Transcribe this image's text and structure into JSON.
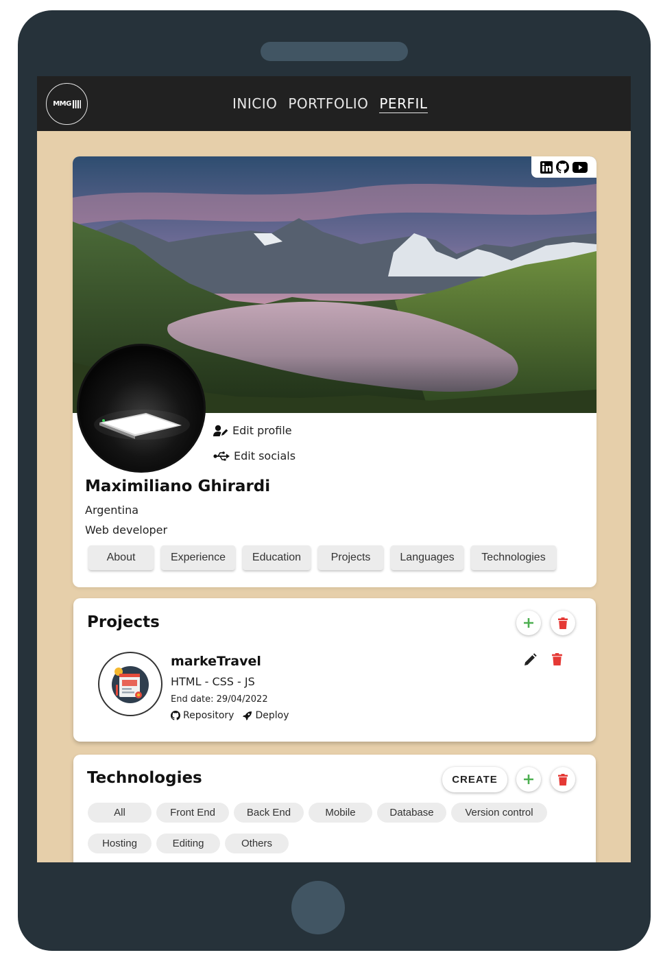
{
  "navbar": {
    "logo_text": "MMG",
    "links": [
      "INICIO",
      "PORTFOLIO",
      "PERFIL"
    ],
    "active_link": "PERFIL"
  },
  "socials": [
    "linkedin-icon",
    "github-icon",
    "youtube-icon"
  ],
  "profile": {
    "edit_profile_label": "Edit profile",
    "edit_socials_label": "Edit socials",
    "name": "Maximiliano Ghirardi",
    "country": "Argentina",
    "role": "Web developer",
    "tabs": [
      "About",
      "Experience",
      "Education",
      "Projects",
      "Languages",
      "Technologies"
    ]
  },
  "projects": {
    "title": "Projects",
    "items": [
      {
        "name": "markeTravel",
        "tech": "HTML - CSS - JS",
        "end_date": "End date: 29/04/2022",
        "repo_label": "Repository",
        "deploy_label": "Deploy"
      }
    ]
  },
  "technologies": {
    "title": "Technologies",
    "create_label": "CREATE",
    "filters_row1": [
      "All",
      "Front End",
      "Back End",
      "Mobile",
      "Database",
      "Version control"
    ],
    "filters_row2": [
      "Hosting",
      "Editing",
      "Others"
    ]
  },
  "colors": {
    "device": "#26323a",
    "page_bg": "#e6cfaa",
    "navbar": "#212121",
    "add": "#4caf50",
    "delete": "#e53935"
  }
}
